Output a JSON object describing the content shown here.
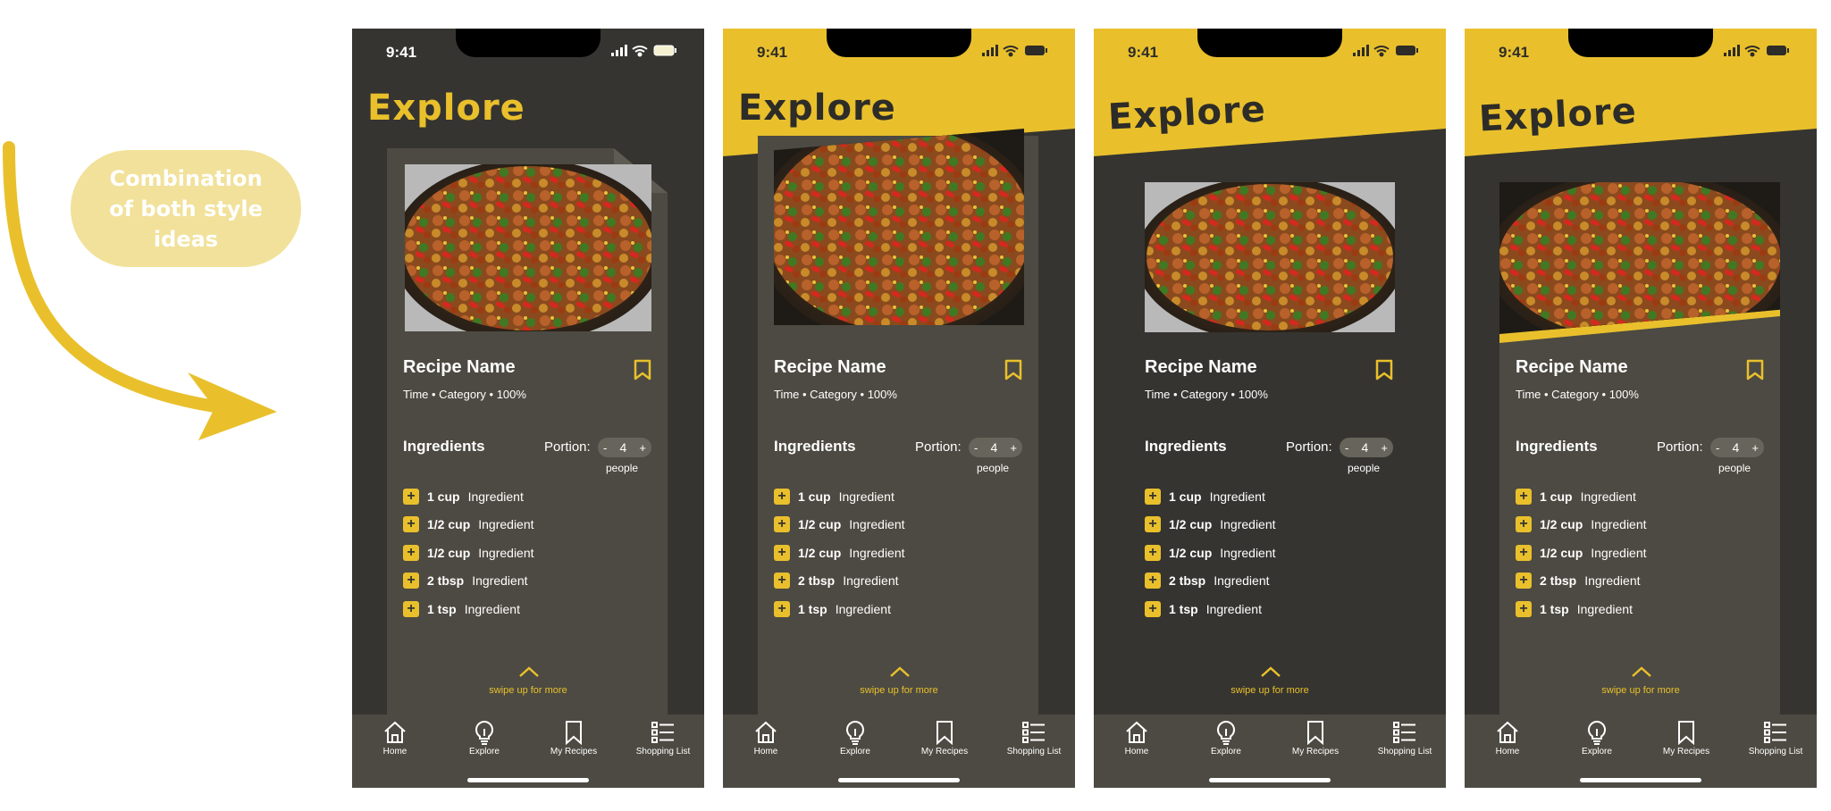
{
  "annotation": {
    "note": "Combination of both style ideas"
  },
  "colors": {
    "accent": "#e9c02c",
    "background": "#353430",
    "card": "#4c4a42",
    "note_bubble": "#f1e19a"
  },
  "phones": [
    {
      "time": "9:41",
      "title": "Explore"
    },
    {
      "time": "9:41",
      "title": "Explore"
    },
    {
      "time": "9:41",
      "title": "Explore"
    },
    {
      "time": "9:41",
      "title": "Explore"
    }
  ],
  "recipe": {
    "name": "Recipe Name",
    "meta": "Time • Category • 100%",
    "ingredients_title": "Ingredients",
    "portion_label": "Portion:",
    "portion_minus": "-",
    "portion_value": "4",
    "portion_plus": "+",
    "portion_unit": "people",
    "ingredients": [
      {
        "qty": "1 cup",
        "name": "Ingredient"
      },
      {
        "qty": "1/2 cup",
        "name": "Ingredient"
      },
      {
        "qty": "1/2 cup",
        "name": "Ingredient"
      },
      {
        "qty": "2 tbsp",
        "name": "Ingredient"
      },
      {
        "qty": "1 tsp",
        "name": "Ingredient"
      }
    ],
    "swipe_hint": "swipe up for more"
  },
  "tabbar": {
    "home": "Home",
    "explore": "Explore",
    "my_recipes": "My Recipes",
    "shopping_list": "Shopping List"
  },
  "icons": [
    "signal-icon",
    "wifi-icon",
    "battery-icon",
    "bookmark-icon",
    "plus-icon",
    "chevron-up-icon",
    "home-icon",
    "lightbulb-icon",
    "bookmark-tab-icon",
    "list-icon"
  ]
}
